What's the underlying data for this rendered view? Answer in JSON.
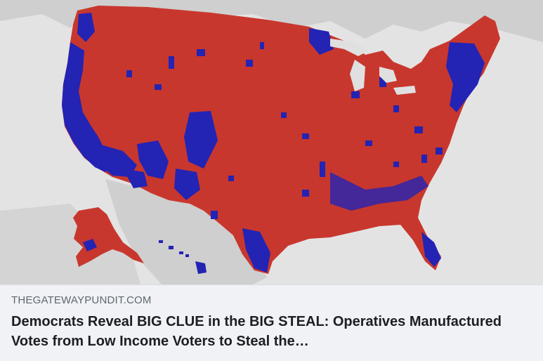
{
  "link_preview": {
    "image_description_label": "county election map",
    "source_domain": "THEGATEWAYPUNDIT.COM",
    "headline": "Democrats Reveal BIG CLUE in the BIG STEAL: Operatives Manufactured Votes from Low Income Voters to Steal the…"
  },
  "colors": {
    "republican_red": "#c8372d",
    "democrat_blue": "#2323b4",
    "land_gray": "#c9c9c9",
    "water_gray": "#e2e2e2",
    "caption_bg": "#f0f2f5"
  }
}
